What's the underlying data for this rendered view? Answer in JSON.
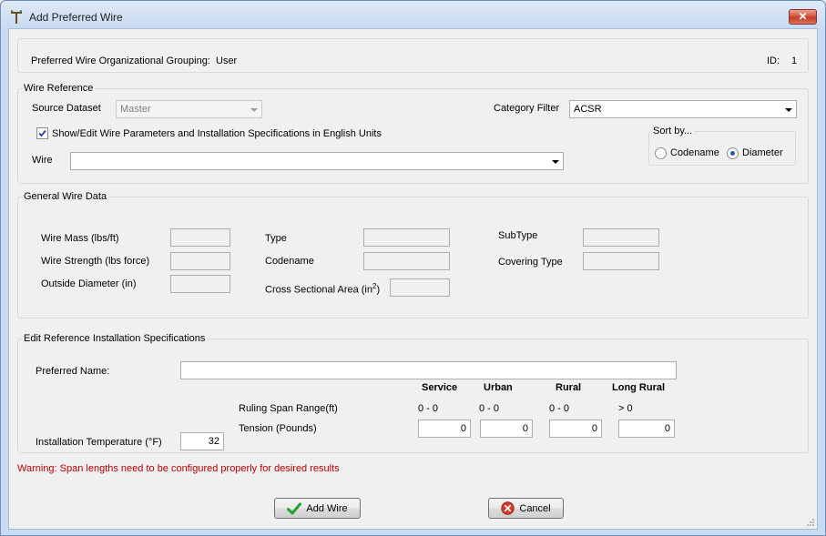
{
  "window": {
    "title": "Add Preferred Wire",
    "close_label": "✕"
  },
  "grouping": {
    "label": "Preferred Wire Organizational Grouping:",
    "value": "User",
    "id_label": "ID:",
    "id_value": "1"
  },
  "wire_reference": {
    "legend": "Wire Reference",
    "source_dataset_label": "Source Dataset",
    "source_dataset_value": "Master",
    "category_filter_label": "Category Filter",
    "category_filter_value": "ACSR",
    "english_units_label": "Show/Edit Wire Parameters and Installation Specifications in English Units",
    "english_units_checked": true,
    "wire_label": "Wire",
    "wire_value": "",
    "sort_by": {
      "legend": "Sort by...",
      "options": [
        "Codename",
        "Diameter"
      ],
      "selected": "Diameter"
    }
  },
  "general_wire_data": {
    "legend": "General Wire Data",
    "wire_mass_label": "Wire Mass (lbs/ft)",
    "wire_strength_label": "Wire Strength (lbs force)",
    "outside_diameter_label": "Outside Diameter (in)",
    "type_label": "Type",
    "codename_label": "Codename",
    "cross_area_label": "Cross Sectional Area (in",
    "cross_area_sup": "2",
    "cross_area_suffix": ")",
    "subtype_label": "SubType",
    "covering_type_label": "Covering Type",
    "wire_mass_value": "",
    "wire_strength_value": "",
    "outside_diameter_value": "",
    "type_value": "",
    "codename_value": "",
    "cross_area_value": "",
    "subtype_value": "",
    "covering_type_value": ""
  },
  "installation": {
    "legend": "Edit Reference Installation Specifications",
    "preferred_name_label": "Preferred Name:",
    "preferred_name_value": "",
    "columns": [
      "Service",
      "Urban",
      "Rural",
      "Long Rural"
    ],
    "ruling_span_label": "Ruling Span Range(ft)",
    "ruling_span_values": [
      "0 - 0",
      "0 - 0",
      "0 - 0",
      "> 0"
    ],
    "tension_label": "Tension (Pounds)",
    "tension_values": [
      "0",
      "0",
      "0",
      "0"
    ],
    "install_temp_label": "Installation Temperature (°F)",
    "install_temp_value": "32"
  },
  "warning_text": "Warning: Span lengths need to be configured properly for desired results",
  "buttons": {
    "add_wire": "Add Wire",
    "cancel": "Cancel"
  },
  "colors": {
    "warning": "#c00000",
    "accent_check": "#21a330",
    "cancel_red": "#d23b2b"
  }
}
